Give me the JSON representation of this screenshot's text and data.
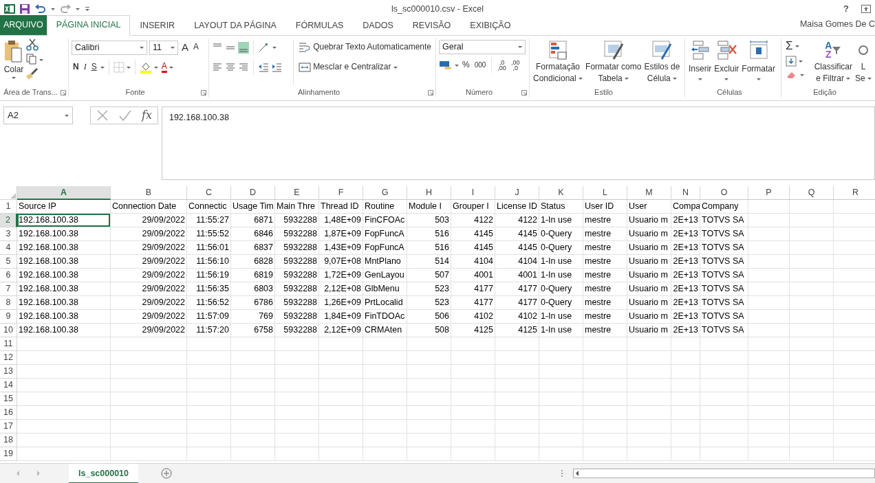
{
  "title_bar": {
    "title": "ls_sc000010.csv - Excel",
    "help": "?"
  },
  "tabs": [
    {
      "label": "ARQUIVO",
      "kind": "file"
    },
    {
      "label": "PÁGINA INICIAL",
      "kind": "tab",
      "selected": true
    },
    {
      "label": "INSERIR",
      "kind": "tab",
      "selected": false
    },
    {
      "label": "LAYOUT DA PÁGINA",
      "kind": "tab",
      "selected": false
    },
    {
      "label": "FÓRMULAS",
      "kind": "tab",
      "selected": false
    },
    {
      "label": "DADOS",
      "kind": "tab",
      "selected": false
    },
    {
      "label": "REVISÃO",
      "kind": "tab",
      "selected": false
    },
    {
      "label": "EXIBIÇÃO",
      "kind": "tab",
      "selected": false
    }
  ],
  "user": "Maisa Gomes De C",
  "ribbon": {
    "clipboard": {
      "label": "Área de Trans...",
      "paste": "Colar"
    },
    "font": {
      "label": "Fonte",
      "font_name": "Calibri",
      "font_size": "11",
      "grow_font": "A",
      "shrink_font": "A",
      "bold": "N",
      "italic": "I",
      "underline": "S",
      "font_color": "A"
    },
    "alignment": {
      "label": "Alinhamento",
      "vertical_align": [
        {
          "selected": false
        },
        {
          "selected": false
        },
        {
          "selected": true
        }
      ],
      "wrap_text": "Quebrar Texto Automaticamente",
      "merge": "Mesclar e Centralizar"
    },
    "number": {
      "label": "Número",
      "format": "Geral",
      "percent": "%",
      "thousands": "000",
      "increase_decimal": [
        ",0",
        ",00"
      ],
      "decrease_decimal": [
        ",00",
        ",0"
      ]
    },
    "styles": {
      "label": "Estilo",
      "buttons": [
        {
          "lines": [
            "Formatação",
            "Condicional"
          ]
        },
        {
          "lines": [
            "Formatar como",
            "Tabela"
          ]
        },
        {
          "lines": [
            "Estilos de",
            "Célula"
          ]
        }
      ]
    },
    "cells": {
      "label": "Células",
      "buttons": [
        "Inserir",
        "Excluir",
        "Formatar"
      ]
    },
    "editing": {
      "label": "Edição",
      "autosum": "Σ",
      "sort_letters": [
        "A",
        "Z"
      ],
      "buttons": [
        {
          "lines": [
            "Classificar",
            "e Filtrar"
          ]
        },
        {
          "lines": [
            "L",
            "Se"
          ]
        }
      ]
    }
  },
  "formula_bar": {
    "name_box": "A2",
    "fx": "fx",
    "value": "192.168.100.38"
  },
  "sheet": {
    "columns": [
      {
        "letter": "A",
        "right_aligned": false,
        "selected": true
      },
      {
        "letter": "B",
        "right_aligned": true,
        "selected": false
      },
      {
        "letter": "C",
        "right_aligned": true,
        "selected": false
      },
      {
        "letter": "D",
        "right_aligned": true,
        "selected": false
      },
      {
        "letter": "E",
        "right_aligned": true,
        "selected": false
      },
      {
        "letter": "F",
        "right_aligned": true,
        "selected": false
      },
      {
        "letter": "G",
        "right_aligned": false,
        "selected": false
      },
      {
        "letter": "H",
        "right_aligned": true,
        "selected": false
      },
      {
        "letter": "I",
        "right_aligned": true,
        "selected": false
      },
      {
        "letter": "J",
        "right_aligned": true,
        "selected": false
      },
      {
        "letter": "K",
        "right_aligned": false,
        "selected": false
      },
      {
        "letter": "L",
        "right_aligned": false,
        "selected": false
      },
      {
        "letter": "M",
        "right_aligned": false,
        "selected": false
      },
      {
        "letter": "N",
        "right_aligned": true,
        "selected": false
      },
      {
        "letter": "O",
        "right_aligned": false,
        "selected": false
      },
      {
        "letter": "P",
        "selected": false
      },
      {
        "letter": "Q",
        "selected": false
      },
      {
        "letter": "R",
        "selected": false
      }
    ],
    "rows": [
      {
        "number": "1",
        "kind": "header",
        "selected": false,
        "cells": [
          "Source IP",
          "Connection Date",
          "Connectic",
          "Usage Tim",
          "Main Thre",
          "Thread ID",
          "Routine",
          "Module I",
          "Grouper I",
          "License ID",
          "Status",
          "User ID",
          "User",
          "Compa",
          "Company"
        ]
      },
      {
        "number": "2",
        "kind": "data",
        "selected": true,
        "cells": [
          "192.168.100.38",
          "29/09/2022",
          "11:55:27",
          "6871",
          "5932288",
          "1,48E+09",
          "FinCFOAc",
          "503",
          "4122",
          "4122",
          "1-In use",
          "mestre",
          "Usuario m",
          "2E+13",
          "TOTVS SA"
        ]
      },
      {
        "number": "3",
        "kind": "data",
        "selected": false,
        "cells": [
          "192.168.100.38",
          "29/09/2022",
          "11:55:52",
          "6846",
          "5932288",
          "1,87E+09",
          "FopFuncA",
          "516",
          "4145",
          "4145",
          "0-Query",
          "mestre",
          "Usuario m",
          "2E+13",
          "TOTVS SA"
        ]
      },
      {
        "number": "4",
        "kind": "data",
        "selected": false,
        "cells": [
          "192.168.100.38",
          "29/09/2022",
          "11:56:01",
          "6837",
          "5932288",
          "1,43E+09",
          "FopFuncA",
          "516",
          "4145",
          "4145",
          "0-Query",
          "mestre",
          "Usuario m",
          "2E+13",
          "TOTVS SA"
        ]
      },
      {
        "number": "5",
        "kind": "data",
        "selected": false,
        "cells": [
          "192.168.100.38",
          "29/09/2022",
          "11:56:10",
          "6828",
          "5932288",
          "9,07E+08",
          "MntPlano",
          "514",
          "4104",
          "4104",
          "1-In use",
          "mestre",
          "Usuario m",
          "2E+13",
          "TOTVS SA"
        ]
      },
      {
        "number": "6",
        "kind": "data",
        "selected": false,
        "cells": [
          "192.168.100.38",
          "29/09/2022",
          "11:56:19",
          "6819",
          "5932288",
          "1,72E+09",
          "GenLayou",
          "507",
          "4001",
          "4001",
          "1-In use",
          "mestre",
          "Usuario m",
          "2E+13",
          "TOTVS SA"
        ]
      },
      {
        "number": "7",
        "kind": "data",
        "selected": false,
        "cells": [
          "192.168.100.38",
          "29/09/2022",
          "11:56:35",
          "6803",
          "5932288",
          "2,12E+08",
          "GlbMenu",
          "523",
          "4177",
          "4177",
          "0-Query",
          "mestre",
          "Usuario m",
          "2E+13",
          "TOTVS SA"
        ]
      },
      {
        "number": "8",
        "kind": "data",
        "selected": false,
        "cells": [
          "192.168.100.38",
          "29/09/2022",
          "11:56:52",
          "6786",
          "5932288",
          "1,26E+09",
          "PrtLocalid",
          "523",
          "4177",
          "4177",
          "0-Query",
          "mestre",
          "Usuario m",
          "2E+13",
          "TOTVS SA"
        ]
      },
      {
        "number": "9",
        "kind": "data",
        "selected": false,
        "cells": [
          "192.168.100.38",
          "29/09/2022",
          "11:57:09",
          "769",
          "5932288",
          "1,84E+09",
          "FinTDOAc",
          "506",
          "4102",
          "4102",
          "1-In use",
          "mestre",
          "Usuario m",
          "2E+13",
          "TOTVS SA"
        ]
      },
      {
        "number": "10",
        "kind": "data",
        "selected": false,
        "cells": [
          "192.168.100.38",
          "29/09/2022",
          "11:57:20",
          "6758",
          "5932288",
          "2,12E+09",
          "CRMAten",
          "508",
          "4125",
          "4125",
          "1-In use",
          "mestre",
          "Usuario m",
          "2E+13",
          "TOTVS SA"
        ]
      },
      {
        "number": "11",
        "selected": false
      },
      {
        "number": "12",
        "selected": false
      },
      {
        "number": "13",
        "selected": false
      },
      {
        "number": "14",
        "selected": false
      },
      {
        "number": "15",
        "selected": false
      },
      {
        "number": "16",
        "selected": false
      },
      {
        "number": "17",
        "selected": false
      },
      {
        "number": "18",
        "selected": false
      },
      {
        "number": "19",
        "selected": false
      }
    ]
  },
  "sheet_tabs": [
    {
      "label": "ls_sc000010",
      "selected": true
    }
  ]
}
